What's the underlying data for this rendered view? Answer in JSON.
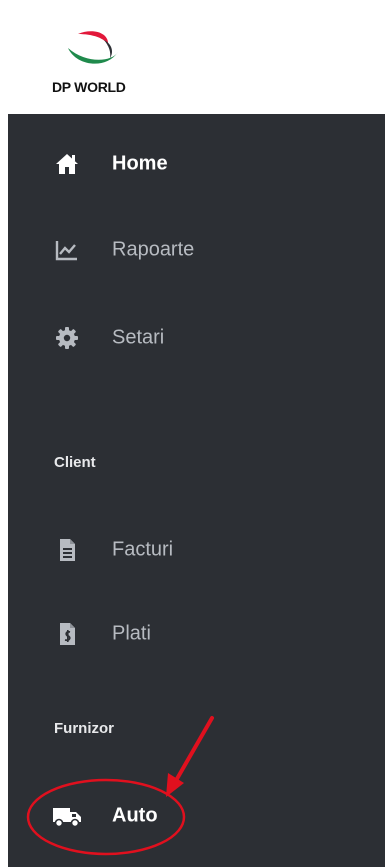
{
  "brand": {
    "name": "DP WORLD",
    "logo_icon": "dp-world-swoosh-logo",
    "colors": {
      "red": "#e2183a",
      "green": "#1f8a4c",
      "dark": "#111111"
    }
  },
  "sidebar": {
    "background": "#2c2f34",
    "items": [
      {
        "label": "Home",
        "icon": "home-icon",
        "active": true
      },
      {
        "label": "Rapoarte",
        "icon": "chart-line-icon",
        "active": false
      },
      {
        "label": "Setari",
        "icon": "gear-icon",
        "active": false
      }
    ],
    "sections": [
      {
        "title": "Client",
        "items": [
          {
            "label": "Facturi",
            "icon": "invoice-file-icon"
          },
          {
            "label": "Plati",
            "icon": "payment-file-icon"
          }
        ]
      },
      {
        "title": "Furnizor",
        "items": [
          {
            "label": "Auto",
            "icon": "truck-icon",
            "active": true
          }
        ]
      }
    ]
  },
  "annotation": {
    "color": "#e0101e"
  }
}
